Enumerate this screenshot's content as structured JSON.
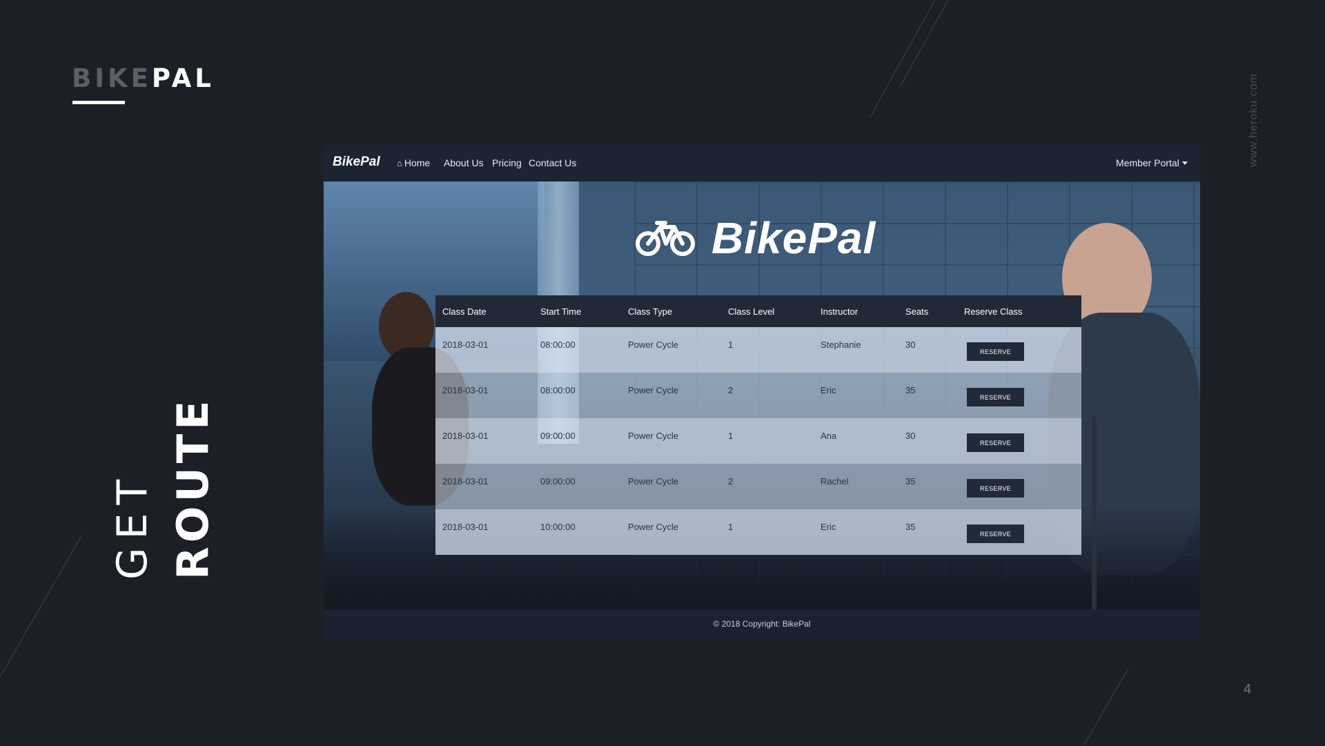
{
  "slide": {
    "brand_part1": "BIKE",
    "brand_part2": "PAL",
    "title_line1": "GET",
    "title_line2": "ROUTE",
    "side_url": "www.heroku.com",
    "page_number": "4"
  },
  "app": {
    "nav": {
      "logo": "BikePal",
      "home_icon": "home-icon",
      "items": [
        "Home",
        "About Us",
        "Pricing",
        "Contact Us"
      ],
      "member_portal": "Member Portal"
    },
    "hero_title": "BikePal",
    "hero_icon": "bicycle-icon",
    "table": {
      "headers": [
        "Class Date",
        "Start Time",
        "Class Type",
        "Class Level",
        "Instructor",
        "Seats",
        "Reserve Class"
      ],
      "rows": [
        {
          "date": "2018-03-01",
          "time": "08:00:00",
          "type": "Power Cycle",
          "level": "1",
          "instructor": "Stephanie",
          "seats": "30",
          "button": "RESERVE"
        },
        {
          "date": "2018-03-01",
          "time": "08:00:00",
          "type": "Power Cycle",
          "level": "2",
          "instructor": "Eric",
          "seats": "35",
          "button": "RESERVE"
        },
        {
          "date": "2018-03-01",
          "time": "09:00:00",
          "type": "Power Cycle",
          "level": "1",
          "instructor": "Ana",
          "seats": "30",
          "button": "RESERVE"
        },
        {
          "date": "2018-03-01",
          "time": "09:00:00",
          "type": "Power Cycle",
          "level": "2",
          "instructor": "Rachel",
          "seats": "35",
          "button": "RESERVE"
        },
        {
          "date": "2018-03-01",
          "time": "10:00:00",
          "type": "Power Cycle",
          "level": "1",
          "instructor": "Eric",
          "seats": "35",
          "button": "RESERVE"
        }
      ]
    },
    "footer": "© 2018 Copyright: BikePal"
  }
}
